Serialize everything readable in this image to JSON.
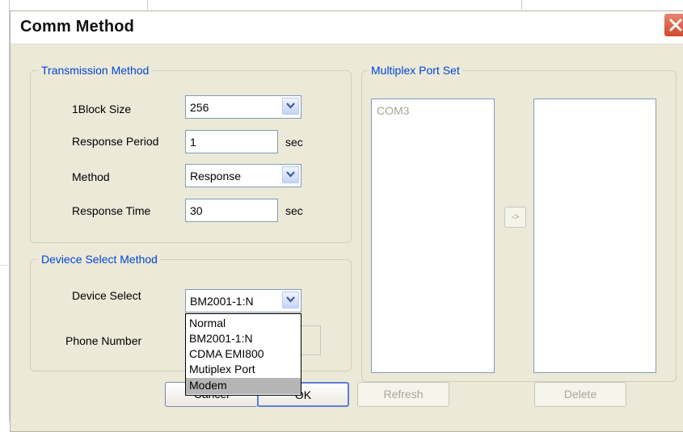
{
  "dialog": {
    "title": "Comm Method"
  },
  "transmission": {
    "group_title": "Transmission Method",
    "block_size_label": "1Block Size",
    "block_size_value": "256",
    "response_period_label": "Response Period",
    "response_period_value": "1",
    "response_period_unit": "sec",
    "method_label": "Method",
    "method_value": "Response",
    "response_time_label": "Response Time",
    "response_time_value": "30",
    "response_time_unit": "sec"
  },
  "device": {
    "group_title": "Deviece Select Method",
    "device_select_label": "Device Select",
    "device_select_value": "BM2001-1:N",
    "phone_number_label": "Phone Number",
    "dropdown_options": [
      "Normal",
      "BM2001-1:N",
      "CDMA EMI800",
      "Mutiplex Port",
      "Modem"
    ],
    "highlighted_option": "Modem"
  },
  "multiplex": {
    "group_title": "Multiplex Port Set",
    "left_list": [
      "COM3"
    ],
    "right_list": [],
    "move_button_label": "->"
  },
  "buttons": {
    "cancel": "Cancel",
    "ok": "OK",
    "refresh": "Refresh",
    "delete": "Delete"
  },
  "colors": {
    "dialog_bg": "#ece9d8",
    "group_title": "#0046d5",
    "disabled_text": "#a7a697",
    "highlight": "#b5b5b5"
  }
}
